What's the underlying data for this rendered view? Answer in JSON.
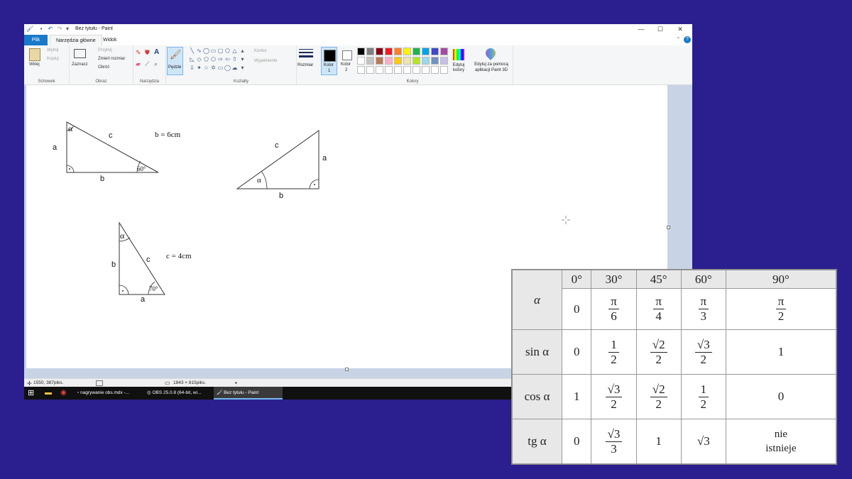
{
  "window": {
    "title": "Bez tytułu - Paint",
    "controls": [
      "—",
      "☐",
      "✕"
    ]
  },
  "ribbon_tabs": [
    "Plik",
    "Narzędzia główne",
    "Widok"
  ],
  "ribbon": {
    "clipboard": {
      "paste": "Wklej",
      "cut": "Wytnij",
      "copy": "Kopiuj",
      "group": "Schowek"
    },
    "image": {
      "select": "Zaznacz",
      "crop": "Przytnij",
      "resize": "Zmień rozmiar",
      "rotate": "Obróć",
      "group": "Obraz"
    },
    "tools": {
      "group": "Narzędzia"
    },
    "brushes": {
      "label": "Pędzle"
    },
    "shapes": {
      "outline": "Kontur",
      "fill": "Wypełnienie",
      "group": "Kształty"
    },
    "size": {
      "label": "Rozmiar"
    },
    "color1": {
      "label": "Kolor",
      "sub": "1"
    },
    "color2": {
      "label": "Kolor",
      "sub": "2"
    },
    "colors": {
      "group": "Kolory",
      "edit": "Edytuj kolory",
      "paint3d": "Edytuj za pomocą aplikacji Paint 3D",
      "palette_top": [
        "#000000",
        "#7f7f7f",
        "#880015",
        "#ed1c24",
        "#ff7f27",
        "#fff200",
        "#22b14c",
        "#00a2e8",
        "#3f48cc",
        "#a349a4"
      ],
      "palette_bottom": [
        "#ffffff",
        "#c3c3c3",
        "#b97a57",
        "#ffaec9",
        "#ffc90e",
        "#efe4b0",
        "#b5e61d",
        "#99d9ea",
        "#7092be",
        "#c8bfe7"
      ]
    }
  },
  "canvas": {
    "triangle1": {
      "alpha": "α",
      "a": "a",
      "b": "b",
      "c": "c",
      "angle": "60°",
      "given": "b = 6cm"
    },
    "triangle2": {
      "alpha": "α",
      "a": "a",
      "b": "b",
      "c": "c"
    },
    "triangle3": {
      "alpha": "α",
      "a": "a",
      "b": "b",
      "c": "c",
      "angle": "70°",
      "given": "c = 4cm"
    }
  },
  "status": {
    "cursor": "1550, 387piks.",
    "size": "1843 × 815piks."
  },
  "taskbar": {
    "items": [
      "nagrywanie obs.mdx -...",
      "OBS 25.0.8 (64-bit, wi...",
      "Bez tytułu - Paint"
    ]
  },
  "trig_table": {
    "alpha": "α",
    "degrees": [
      "0°",
      "30°",
      "45°",
      "60°",
      "90°"
    ],
    "radians": [
      {
        "plain": "0"
      },
      {
        "num": "π",
        "den": "6"
      },
      {
        "num": "π",
        "den": "4"
      },
      {
        "num": "π",
        "den": "3"
      },
      {
        "num": "π",
        "den": "2"
      }
    ],
    "rows": [
      {
        "label": "sin α",
        "values": [
          {
            "plain": "0"
          },
          {
            "num": "1",
            "den": "2"
          },
          {
            "num": "√2",
            "den": "2"
          },
          {
            "num": "√3",
            "den": "2"
          },
          {
            "plain": "1"
          }
        ]
      },
      {
        "label": "cos α",
        "values": [
          {
            "plain": "1"
          },
          {
            "num": "√3",
            "den": "2"
          },
          {
            "num": "√2",
            "den": "2"
          },
          {
            "num": "1",
            "den": "2"
          },
          {
            "plain": "0"
          }
        ]
      },
      {
        "label": "tg α",
        "values": [
          {
            "plain": "0"
          },
          {
            "num": "√3",
            "den": "3"
          },
          {
            "plain": "1"
          },
          {
            "plain": "√3"
          },
          {
            "plain": "nie istnieje"
          }
        ]
      }
    ]
  }
}
